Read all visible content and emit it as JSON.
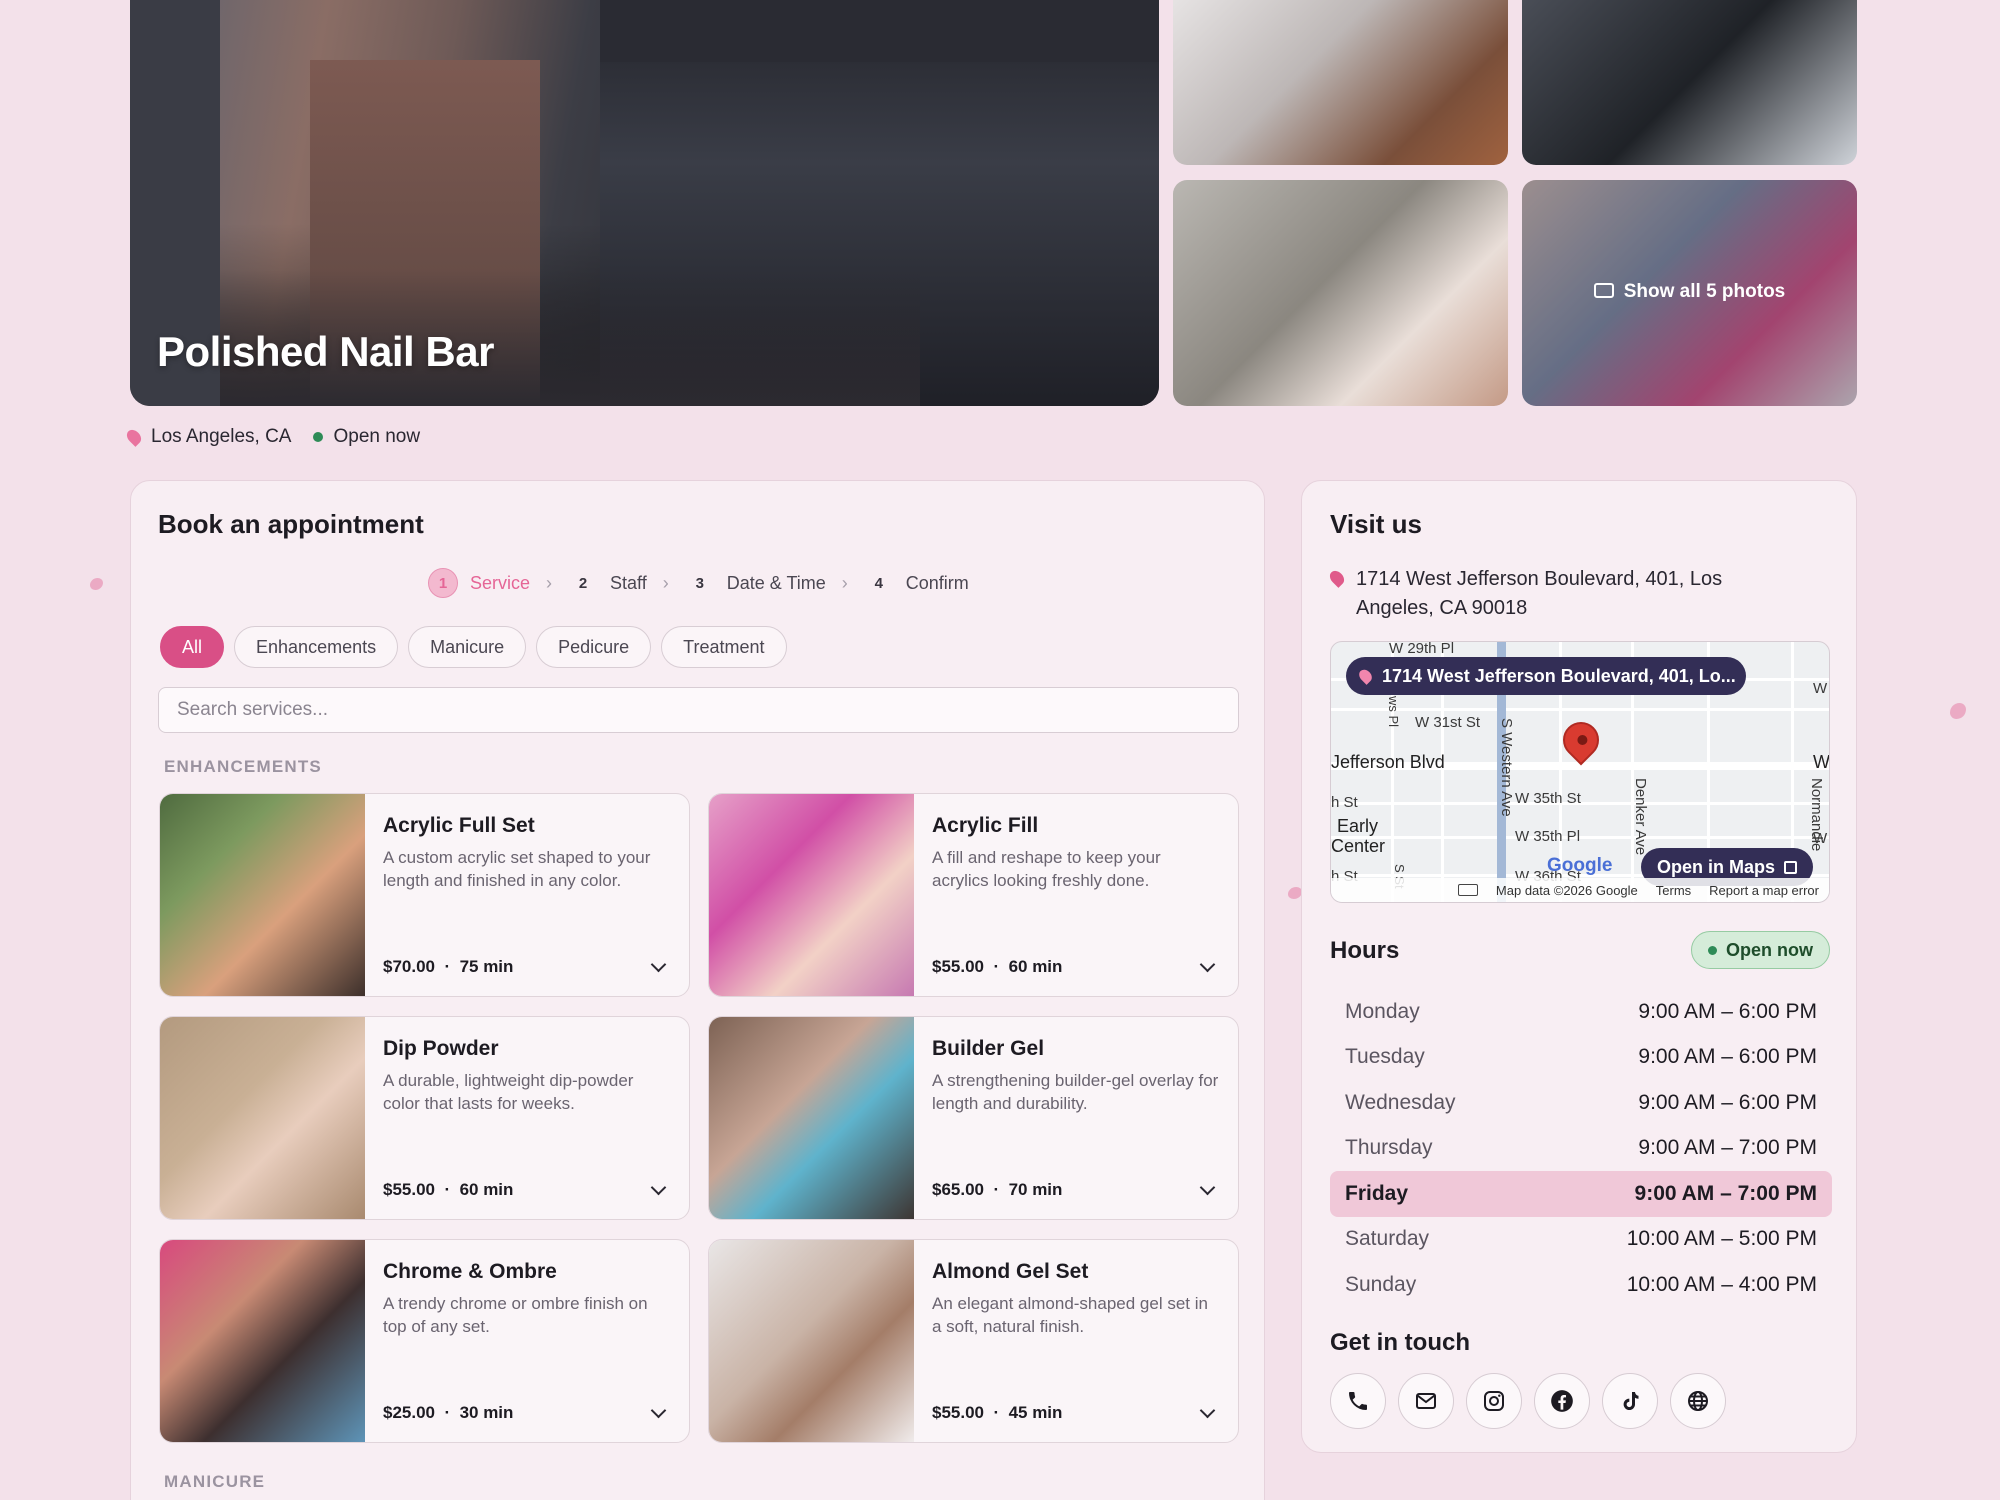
{
  "business": {
    "name": "Polished Nail Bar",
    "location": "Los Angeles, CA",
    "status": "Open now"
  },
  "gallery": {
    "show_all_label": "Show all 5 photos"
  },
  "booking": {
    "title": "Book an appointment",
    "steps": [
      {
        "num": "1",
        "label": "Service"
      },
      {
        "num": "2",
        "label": "Staff"
      },
      {
        "num": "3",
        "label": "Date & Time"
      },
      {
        "num": "4",
        "label": "Confirm"
      }
    ],
    "active_step": 1,
    "filters": [
      "All",
      "Enhancements",
      "Manicure",
      "Pedicure",
      "Treatment"
    ],
    "active_filter": "All",
    "search_placeholder": "Search services...",
    "sections": [
      {
        "label": "ENHANCEMENTS",
        "services": [
          {
            "name": "Acrylic Full Set",
            "description": "A custom acrylic set shaped to your length and finished in any color.",
            "price": "$70.00",
            "duration": "75 min"
          },
          {
            "name": "Acrylic Fill",
            "description": "A fill and reshape to keep your acrylics looking freshly done.",
            "price": "$55.00",
            "duration": "60 min"
          },
          {
            "name": "Dip Powder",
            "description": "A durable, lightweight dip-powder color that lasts for weeks.",
            "price": "$55.00",
            "duration": "60 min"
          },
          {
            "name": "Builder Gel",
            "description": "A strengthening builder-gel overlay for length and durability.",
            "price": "$65.00",
            "duration": "70 min"
          },
          {
            "name": "Chrome & Ombre",
            "description": "A trendy chrome or ombre finish on top of any set.",
            "price": "$25.00",
            "duration": "30 min"
          },
          {
            "name": "Almond Gel Set",
            "description": "An elegant almond-shaped gel set in a soft, natural finish.",
            "price": "$55.00",
            "duration": "45 min"
          }
        ]
      },
      {
        "label": "MANICURE"
      }
    ]
  },
  "visit": {
    "title": "Visit us",
    "address": "1714 West Jefferson Boulevard, 401, Los Angeles, CA 90018",
    "map": {
      "pill": "1714 West Jefferson Boulevard, 401, Lo...",
      "open_label": "Open in Maps",
      "attribution": [
        "Map data ©2026 Google",
        "Terms",
        "Report a map error"
      ],
      "google": "Google",
      "streets": [
        "W 29th Pl",
        "W 30th St",
        "W 31st St",
        "Jefferson Blvd",
        "W 35th St",
        "W 35th Pl",
        "W 36th St",
        "S Western Ave",
        "Denker Ave",
        "Normandie",
        "Early",
        "Center",
        "h St",
        "h St",
        "W",
        "W",
        "W",
        "ws Pl",
        "S St"
      ]
    },
    "hours_title": "Hours",
    "hours_status": "Open now",
    "hours": [
      {
        "day": "Monday",
        "time": "9:00 AM – 6:00 PM"
      },
      {
        "day": "Tuesday",
        "time": "9:00 AM – 6:00 PM"
      },
      {
        "day": "Wednesday",
        "time": "9:00 AM – 6:00 PM"
      },
      {
        "day": "Thursday",
        "time": "9:00 AM – 7:00 PM"
      },
      {
        "day": "Friday",
        "time": "9:00 AM – 7:00 PM"
      },
      {
        "day": "Saturday",
        "time": "10:00 AM – 5:00 PM"
      },
      {
        "day": "Sunday",
        "time": "10:00 AM – 4:00 PM"
      }
    ],
    "today": "Friday",
    "contact_title": "Get in touch",
    "contact_icons": [
      "phone-icon",
      "email-icon",
      "instagram-icon",
      "facebook-icon",
      "tiktok-icon",
      "website-icon"
    ]
  },
  "colors": {
    "accent": "#d94f86",
    "background": "#f3e1ea",
    "map_button": "#332e56",
    "open_green": "#2e8b57"
  }
}
